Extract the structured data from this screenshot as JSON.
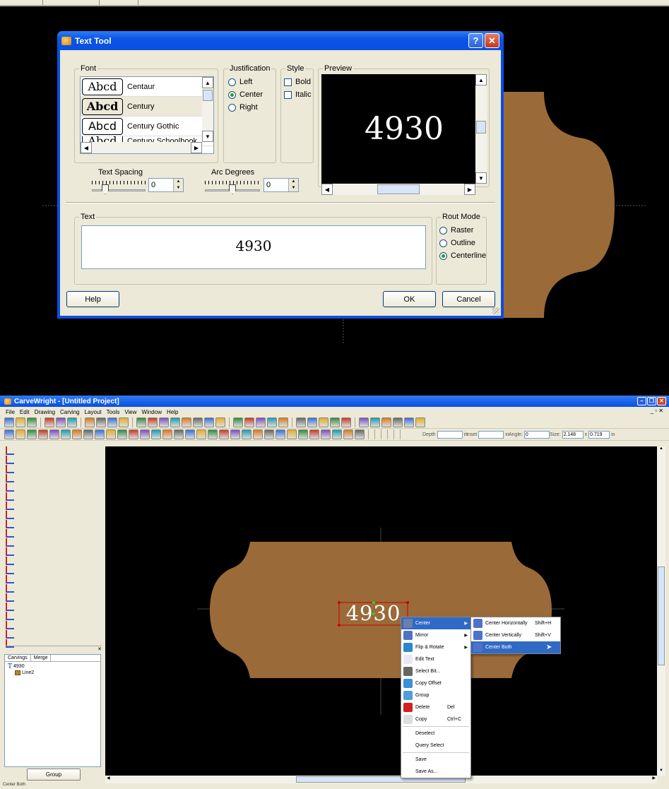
{
  "text_tool": {
    "title": "Text Tool",
    "help_glyph": "?",
    "close_glyph": "✕",
    "font_group": "Font",
    "fonts": [
      {
        "sample": "Abcd",
        "name": "Centaur"
      },
      {
        "sample": "Abcd",
        "name": "Century"
      },
      {
        "sample": "Abcd",
        "name": "Century Gothic"
      },
      {
        "sample": "Abcd",
        "name": "Century Schoolbook"
      }
    ],
    "justification_group": "Justification",
    "justification": [
      "Left",
      "Center",
      "Right"
    ],
    "justification_selected": "Center",
    "style_group": "Style",
    "style": [
      "Bold",
      "Italic"
    ],
    "preview_group": "Preview",
    "preview_text": "4930",
    "text_spacing_label": "Text Spacing",
    "text_spacing_value": "0",
    "arc_degrees_label": "Arc Degrees",
    "arc_degrees_value": "0",
    "text_group": "Text",
    "text_value": "4930",
    "rout_mode_group": "Rout Mode",
    "rout_modes": [
      "Raster",
      "Outline",
      "Centerline"
    ],
    "rout_mode_selected": "Centerline",
    "help_button": "Help",
    "ok_button": "OK",
    "cancel_button": "Cancel"
  },
  "app": {
    "title": "CarveWright - [Untitled Project]",
    "menus": [
      "File",
      "Edit",
      "Drawing",
      "Carving",
      "Layout",
      "Tools",
      "View",
      "Window",
      "Help"
    ],
    "fields": {
      "depth_label": "Depth",
      "depth_unit": "in",
      "inset_label": "Inset",
      "inset_unit": "in",
      "angle_label": "Angle:",
      "angle_value": "0",
      "size_label": "Size:",
      "size_w": "2.148",
      "size_x": "x",
      "size_h": "0.719",
      "size_unit": "in"
    },
    "panel": {
      "tabs": [
        "Carvings",
        "Merge"
      ],
      "tree": [
        "4930",
        "Line2"
      ],
      "group_button": "Group"
    },
    "canvas_text": "4930",
    "status": "Center Both"
  },
  "context_menu": {
    "items": [
      {
        "label": "Center",
        "shortcut": "",
        "submenu": true,
        "icon": "center-icon"
      },
      {
        "label": "Mirror",
        "shortcut": "",
        "submenu": true,
        "icon": "mirror-icon"
      },
      {
        "label": "Flip & Rotate",
        "shortcut": "",
        "submenu": true,
        "icon": "flip-rotate-icon"
      },
      {
        "label": "Edit Text",
        "shortcut": "",
        "submenu": false,
        "icon": "edit-text-icon"
      },
      {
        "label": "Select Bit...",
        "shortcut": "",
        "submenu": false,
        "icon": "bit-icon"
      },
      {
        "label": "Copy Offset",
        "shortcut": "",
        "submenu": false,
        "icon": "copy-offset-icon"
      },
      {
        "label": "Group",
        "shortcut": "",
        "submenu": false,
        "icon": "group-icon"
      },
      {
        "label": "Delete",
        "shortcut": "Del",
        "submenu": false,
        "icon": "delete-icon"
      },
      {
        "label": "Copy",
        "shortcut": "Ctrl+C",
        "submenu": false,
        "icon": "copy-icon"
      },
      {
        "label": "Deselect",
        "shortcut": "",
        "submenu": false,
        "icon": ""
      },
      {
        "label": "Query Select",
        "shortcut": "",
        "submenu": false,
        "icon": ""
      },
      {
        "label": "Save",
        "shortcut": "",
        "submenu": false,
        "icon": ""
      },
      {
        "label": "Save As...",
        "shortcut": "",
        "submenu": false,
        "icon": ""
      }
    ],
    "submenu": [
      {
        "label": "Center Horizontally",
        "shortcut": "Shift+H"
      },
      {
        "label": "Center Vertically",
        "shortcut": "Shift+V"
      },
      {
        "label": "Center Both",
        "shortcut": ""
      }
    ]
  },
  "colors": {
    "board": "#9a6a39",
    "xp_blue": "#0a4fe0",
    "highlight": "#316ac5"
  }
}
